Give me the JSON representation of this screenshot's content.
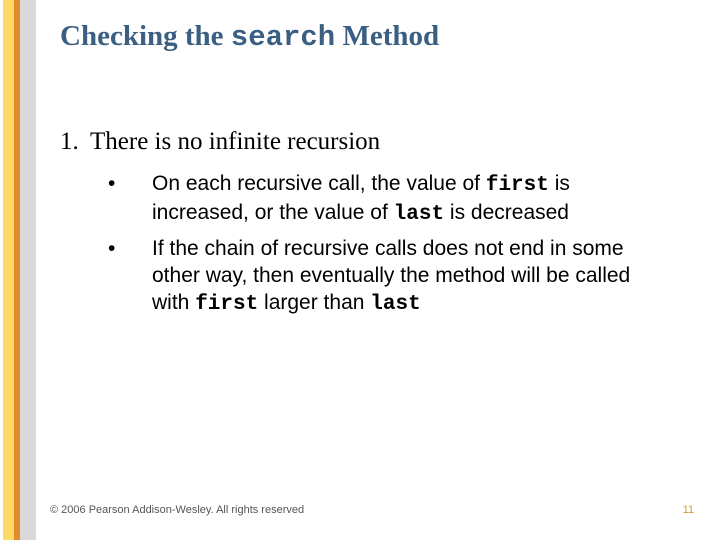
{
  "title": {
    "pre": "Checking the ",
    "code": "search",
    "post": " Method"
  },
  "list": {
    "number": "1.",
    "text": "There is no infinite recursion",
    "sub": [
      {
        "bullet": "•",
        "seg1": "On each recursive call, the value of ",
        "code1": "first",
        "seg2": " is increased, or the value of ",
        "code2": "last",
        "seg3": " is decreased"
      },
      {
        "bullet": "•",
        "seg1": "If the chain of recursive calls does not end in some other way, then eventually the method will be called with ",
        "code1": "first",
        "seg2": " larger than ",
        "code2": "last",
        "seg3": ""
      }
    ]
  },
  "footer": {
    "copyright": "© 2006 Pearson Addison-Wesley. All rights reserved",
    "page": "11"
  }
}
